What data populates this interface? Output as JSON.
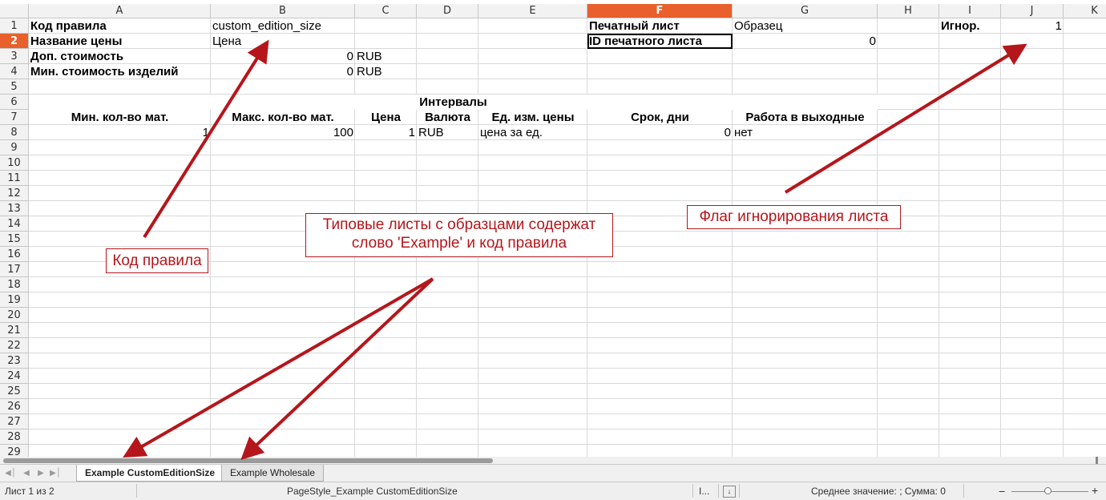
{
  "columns": [
    "A",
    "B",
    "C",
    "D",
    "E",
    "F",
    "G",
    "H",
    "I",
    "J",
    "K"
  ],
  "active_column": "F",
  "active_row": "2",
  "rows": [
    "1",
    "2",
    "3",
    "4",
    "5",
    "6",
    "7",
    "8",
    "9",
    "10",
    "11",
    "12",
    "13",
    "14",
    "15",
    "16",
    "17",
    "18",
    "19",
    "20",
    "21",
    "22",
    "23",
    "24",
    "25",
    "26",
    "27",
    "28",
    "29"
  ],
  "cells": {
    "A1": "Код правила",
    "B1": "custom_edition_size",
    "F1": "Печатный лист",
    "G1": "Образец",
    "I1": "Игнор.",
    "J1": "1",
    "A2": "Название цены",
    "B2": "Цена",
    "F2": "ID печатного листа",
    "G2": "0",
    "A3": "Доп. стоимость",
    "B3": "0",
    "C3": "RUB",
    "A4": "Мин. стоимость изделий",
    "B4": "0",
    "C4": "RUB",
    "A6": "Интервалы",
    "A7": "Мин. кол-во мат.",
    "B7": "Макс. кол-во мат.",
    "C7": "Цена",
    "D7": "Валюта",
    "E7": "Ед. изм. цены",
    "F7": "Срок, дни",
    "G7": "Работа в выходные",
    "A8": "1",
    "B8": "100",
    "C8": "1",
    "D8": "RUB",
    "E8": "цена за ед.",
    "F8": "0",
    "G8": "нет"
  },
  "tabs": [
    "Example CustomEditionSize",
    "Example Wholesale"
  ],
  "status": {
    "sheet": "Лист 1 из 2",
    "page_style": "PageStyle_Example CustomEditionSize",
    "insert_mode": "I...",
    "summary": "Среднее значение: ; Сумма: 0"
  },
  "annotations": {
    "rule_code": "Код правила",
    "sample_sheets": "Типовые листы с образцами содержат слово 'Example' и код правила",
    "ignore_flag": "Флаг игнорирования листа"
  },
  "colors": {
    "accent": "#e8602b",
    "annotation": "#b5161b"
  }
}
